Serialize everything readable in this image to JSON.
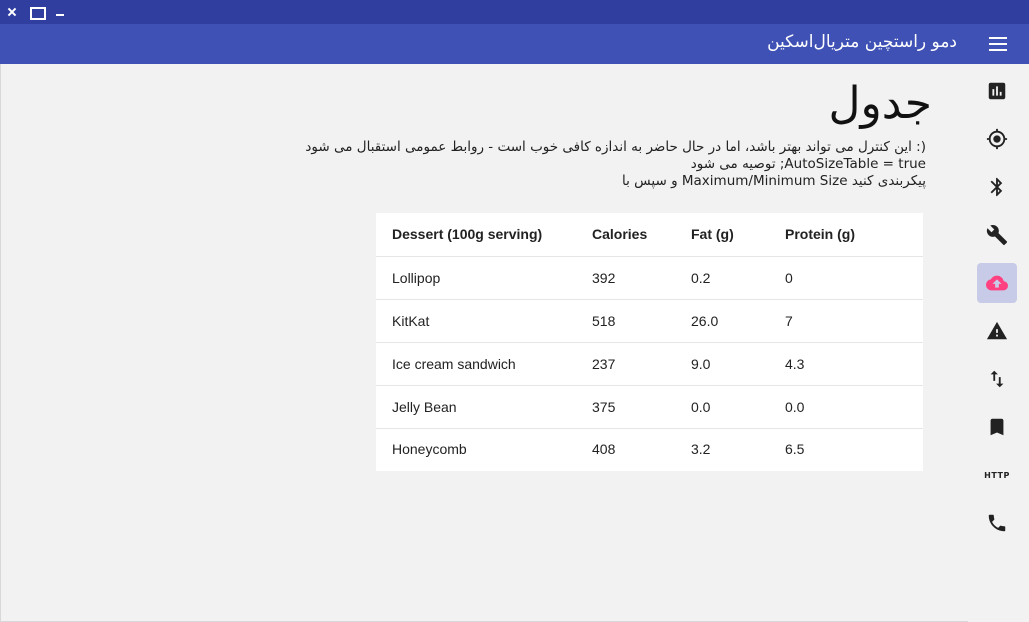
{
  "window": {
    "title": "دمو راستچین متریال‌اسکین"
  },
  "page": {
    "title": "جدول",
    "description": [
      "(: این کنترل می تواند بهتر باشد، اما در حال حاضر به اندازه کافی خوب است - روابط عمومی استقبال می شود",
      "AutoSizeTable = true; توصیه می شود",
      "پیکربندی کنید Maximum/Minimum Size و سپس با"
    ]
  },
  "table": {
    "headers": [
      "Dessert (100g serving)",
      "Calories",
      "Fat (g)",
      "Protein (g)"
    ],
    "rows": [
      [
        "Lollipop",
        "392",
        "0.2",
        "0"
      ],
      [
        "KitKat",
        "518",
        "26.0",
        "7"
      ],
      [
        "Ice cream sandwich",
        "237",
        "9.0",
        "4.3"
      ],
      [
        "Jelly Bean",
        "375",
        "0.0",
        "0.0"
      ],
      [
        "Honeycomb",
        "408",
        "3.2",
        "6.5"
      ]
    ]
  },
  "rail": {
    "items": [
      {
        "icon": "chart-icon"
      },
      {
        "icon": "target-icon"
      },
      {
        "icon": "bluetooth-icon"
      },
      {
        "icon": "wrench-icon"
      },
      {
        "icon": "cloud-upload-icon",
        "active": true
      },
      {
        "icon": "warning-icon"
      },
      {
        "icon": "swap-vertical-icon"
      },
      {
        "icon": "bookmark-icon"
      },
      {
        "icon": "http-icon",
        "label": "HTTP"
      },
      {
        "icon": "phone-icon"
      }
    ]
  },
  "colors": {
    "titlebar": "#303f9f",
    "appbar": "#3f51b5",
    "accent": "#ff4081",
    "active_bg": "#c8cbe8"
  }
}
